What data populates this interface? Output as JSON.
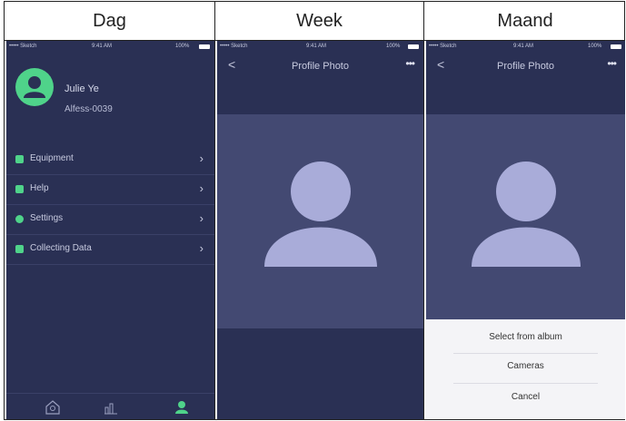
{
  "headers": [
    "Dag",
    "Week",
    "Maand"
  ],
  "status": {
    "carrier": "••••• Sketch",
    "time": "9:41 AM",
    "battery": "100%"
  },
  "profile": {
    "name": "Julie Ye",
    "id": "Alfess-0039"
  },
  "menu": [
    {
      "label": "Equipment",
      "icon": "equipment-icon"
    },
    {
      "label": "Help",
      "icon": "help-icon"
    },
    {
      "label": "Settings",
      "icon": "settings-icon"
    },
    {
      "label": "Collecting Data",
      "icon": "data-icon"
    }
  ],
  "nav": {
    "title": "Profile Photo",
    "back": "<",
    "more": "•••"
  },
  "sheet": {
    "album": "Select from album",
    "camera": "Cameras",
    "cancel": "Cancel"
  },
  "colors": {
    "bg": "#2a3054",
    "accent": "#4fd38a",
    "photo_bg": "#434972",
    "silhouette": "#a9acd9"
  }
}
